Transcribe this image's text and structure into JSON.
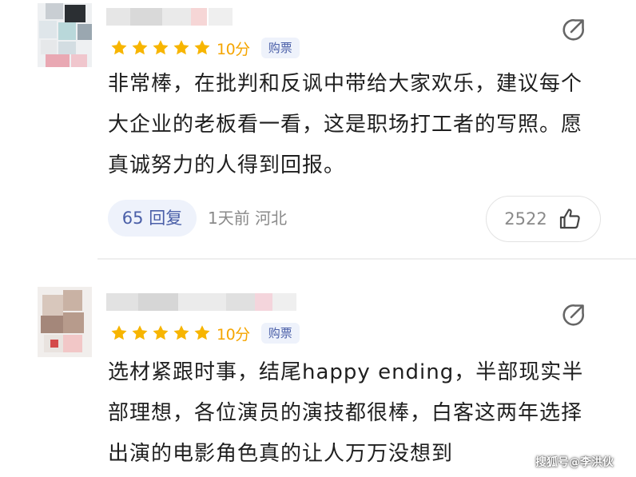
{
  "reviews": [
    {
      "rating_value": 5,
      "score": "10分",
      "tag": "购票",
      "content": "非常棒，在批判和反讽中带给大家欢乐，建议每个大企业的老板看一看，这是职场打工者的写照。愿真诚努力的人得到回报。",
      "reply_label": "65 回复",
      "meta": "1天前 河北",
      "likes": "2522"
    },
    {
      "rating_value": 5,
      "score": "10分",
      "tag": "购票",
      "content": "选材紧跟时事，结尾happy ending，半部现实半部理想，各位演员的演技都很棒，白客这两年选择出演的电影角色真的让人万万没想到"
    }
  ],
  "icons": {
    "star": "star-icon",
    "share": "share-icon",
    "like": "thumbs-up-icon"
  },
  "colors": {
    "star": "#f7b500",
    "score": "#f5a500",
    "tag_bg": "#eef2fb",
    "tag_text": "#4a5fa8",
    "meta": "#8a8a8a"
  },
  "watermark": "搜狐号@李洪伙"
}
